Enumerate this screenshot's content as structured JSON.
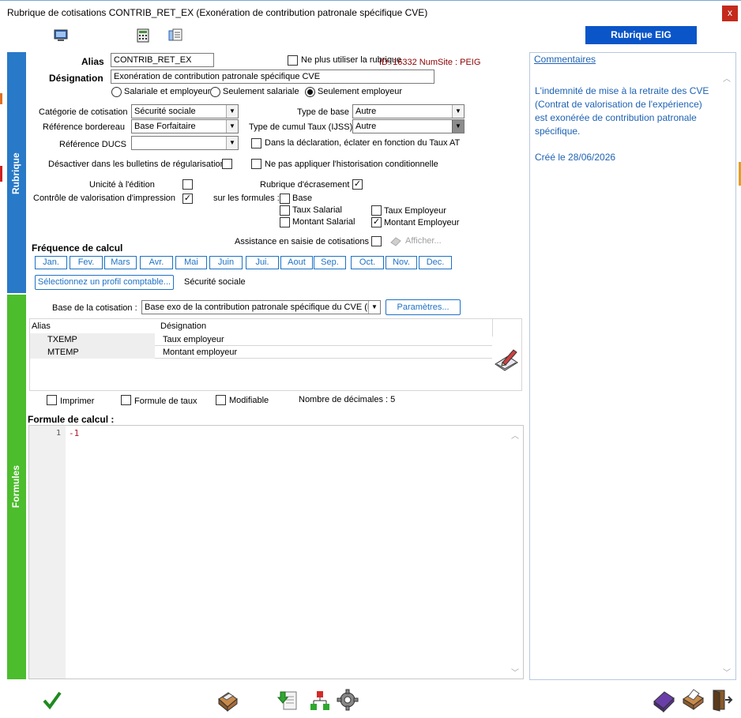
{
  "window": {
    "title": "Rubrique de cotisations CONTRIB_RET_EX (Exonération de contribution patronale spécifique CVE)",
    "close_label": "x"
  },
  "toolbar": {
    "eig_button": "Rubrique EIG"
  },
  "sidebar": {
    "tab1": "Rubrique",
    "tab2": "Formules"
  },
  "form": {
    "alias_label": "Alias",
    "alias_value": "CONTRIB_RET_EX",
    "no_use_label": "Ne plus utiliser la rubrique",
    "id_text": "ID: 16332 NumSite : PEIG",
    "designation_label": "Désignation",
    "designation_value": "Exonération de contribution patronale spécifique CVE",
    "radio_both": "Salariale et employeur",
    "radio_salarial": "Seulement salariale",
    "radio_employeur": "Seulement employeur",
    "categorie_label": "Catégorie de cotisation",
    "categorie_value": "Sécurité sociale",
    "type_base_label": "Type de base",
    "type_base_value": "Autre",
    "ref_bordereau_label": "Référence bordereau",
    "ref_bordereau_value": "Base Forfaitaire",
    "type_cumul_label": "Type de cumul Taux (IJSS)",
    "type_cumul_value": "Autre",
    "ref_ducs_label": "Référence DUCS",
    "ref_ducs_value": "",
    "eclater_label": "Dans la déclaration, éclater en fonction du Taux AT",
    "desactiver_label": "Désactiver dans les bulletins de régularisation",
    "historisation_label": "Ne pas appliquer l'historisation conditionnelle",
    "unicite_label": "Unicité à l'édition",
    "ecrasement_label": "Rubrique d'écrasement",
    "controle_label": "Contrôle de valorisation d'impression",
    "sur_formules_label": "sur les formules :",
    "base_label": "Base",
    "taux_salarial_label": "Taux Salarial",
    "taux_employeur_label": "Taux Employeur",
    "montant_salarial_label": "Montant Salarial",
    "montant_employeur_label": "Montant Employeur",
    "assistance_label": "Assistance en saisie de cotisations",
    "afficher_label": "Afficher...",
    "frequence_label": "Fréquence de calcul",
    "months": [
      "Jan.",
      "Fev.",
      "Mars",
      "Avr.",
      "Mai",
      "Juin",
      "Jui.",
      "Aout",
      "Sep.",
      "Oct.",
      "Nov.",
      "Dec."
    ],
    "profil_button": "Sélectionnez un profil comptable...",
    "profil_value": "Sécurité sociale"
  },
  "formules": {
    "base_label": "Base de la cotisation :",
    "base_value": "Base exo de la contribution patronale spécifique du CVE (BC",
    "parametres_button": "Paramètres...",
    "table_headers": [
      "Alias",
      "Désignation"
    ],
    "rows": [
      {
        "alias": "TXEMP",
        "designation": "Taux employeur"
      },
      {
        "alias": "MTEMP",
        "designation": "Montant employeur"
      }
    ],
    "imprimer_label": "Imprimer",
    "formule_taux_label": "Formule de taux",
    "modifiable_label": "Modifiable",
    "decimales_label": "Nombre de décimales : 5",
    "formule_calcul_label": "Formule de calcul :",
    "line_number": "1",
    "code": "-1"
  },
  "comments": {
    "header": "Commentaires",
    "body": "L'indemnité de mise à la retraite des CVE (Contrat de valorisation de l'expérience) est exonérée de contribution patronale spécifique.",
    "created": "Créé le 28/06/2026"
  }
}
